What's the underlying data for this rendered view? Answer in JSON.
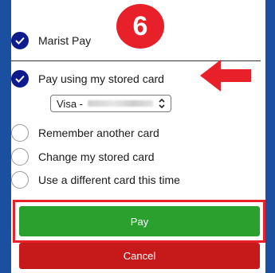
{
  "step_badge": "6",
  "payment_methods": {
    "marist_pay": {
      "label": "Marist Pay",
      "selected": true
    },
    "stored_card": {
      "label": "Pay using my stored card",
      "selected": true
    },
    "card_select": {
      "value": "Visa - "
    },
    "remember_card": {
      "label": "Remember another card",
      "selected": false
    },
    "change_card": {
      "label": "Change my stored card",
      "selected": false
    },
    "different_card": {
      "label": "Use a different card this time",
      "selected": false
    }
  },
  "buttons": {
    "pay_label": "Pay",
    "cancel_label": "Cancel"
  },
  "colors": {
    "page_background": "#1b4fa0",
    "radio_checked": "#0d1b8c",
    "pay_button": "#2aa12e",
    "cancel_button": "#c61a1a",
    "annotation_red": "#e8202a"
  },
  "annotations": {
    "arrow": "arrow-left-icon",
    "highlight_box": "pay-button-highlight"
  }
}
